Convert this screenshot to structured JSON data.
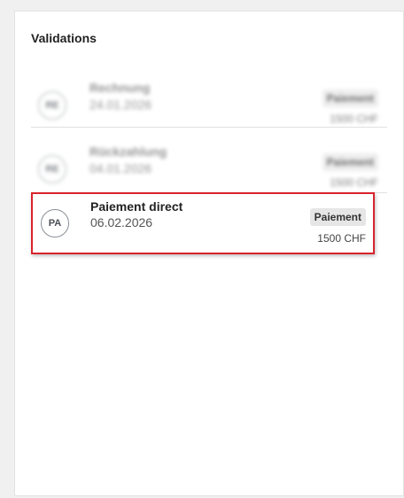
{
  "panel": {
    "title": "Validations",
    "items": [
      {
        "initials": "RE",
        "title": "Rechnung",
        "date": "24.01.2026",
        "badge": "Paiement",
        "amount": "1500 CHF",
        "blurred": true
      },
      {
        "initials": "RE",
        "title": "Rückzahlung",
        "date": "04.01.2026",
        "badge": "Paiement",
        "amount": "1500 CHF",
        "blurred": true
      },
      {
        "initials": "PA",
        "title": "Paiement direct",
        "date": "06.02.2026",
        "badge": "Paiement",
        "amount": "1500 CHF",
        "blurred": false
      }
    ]
  },
  "colors": {
    "highlight_border": "#d9232d",
    "badge_bg": "#e6e6e6",
    "avatar_border": "#8a8f96"
  }
}
